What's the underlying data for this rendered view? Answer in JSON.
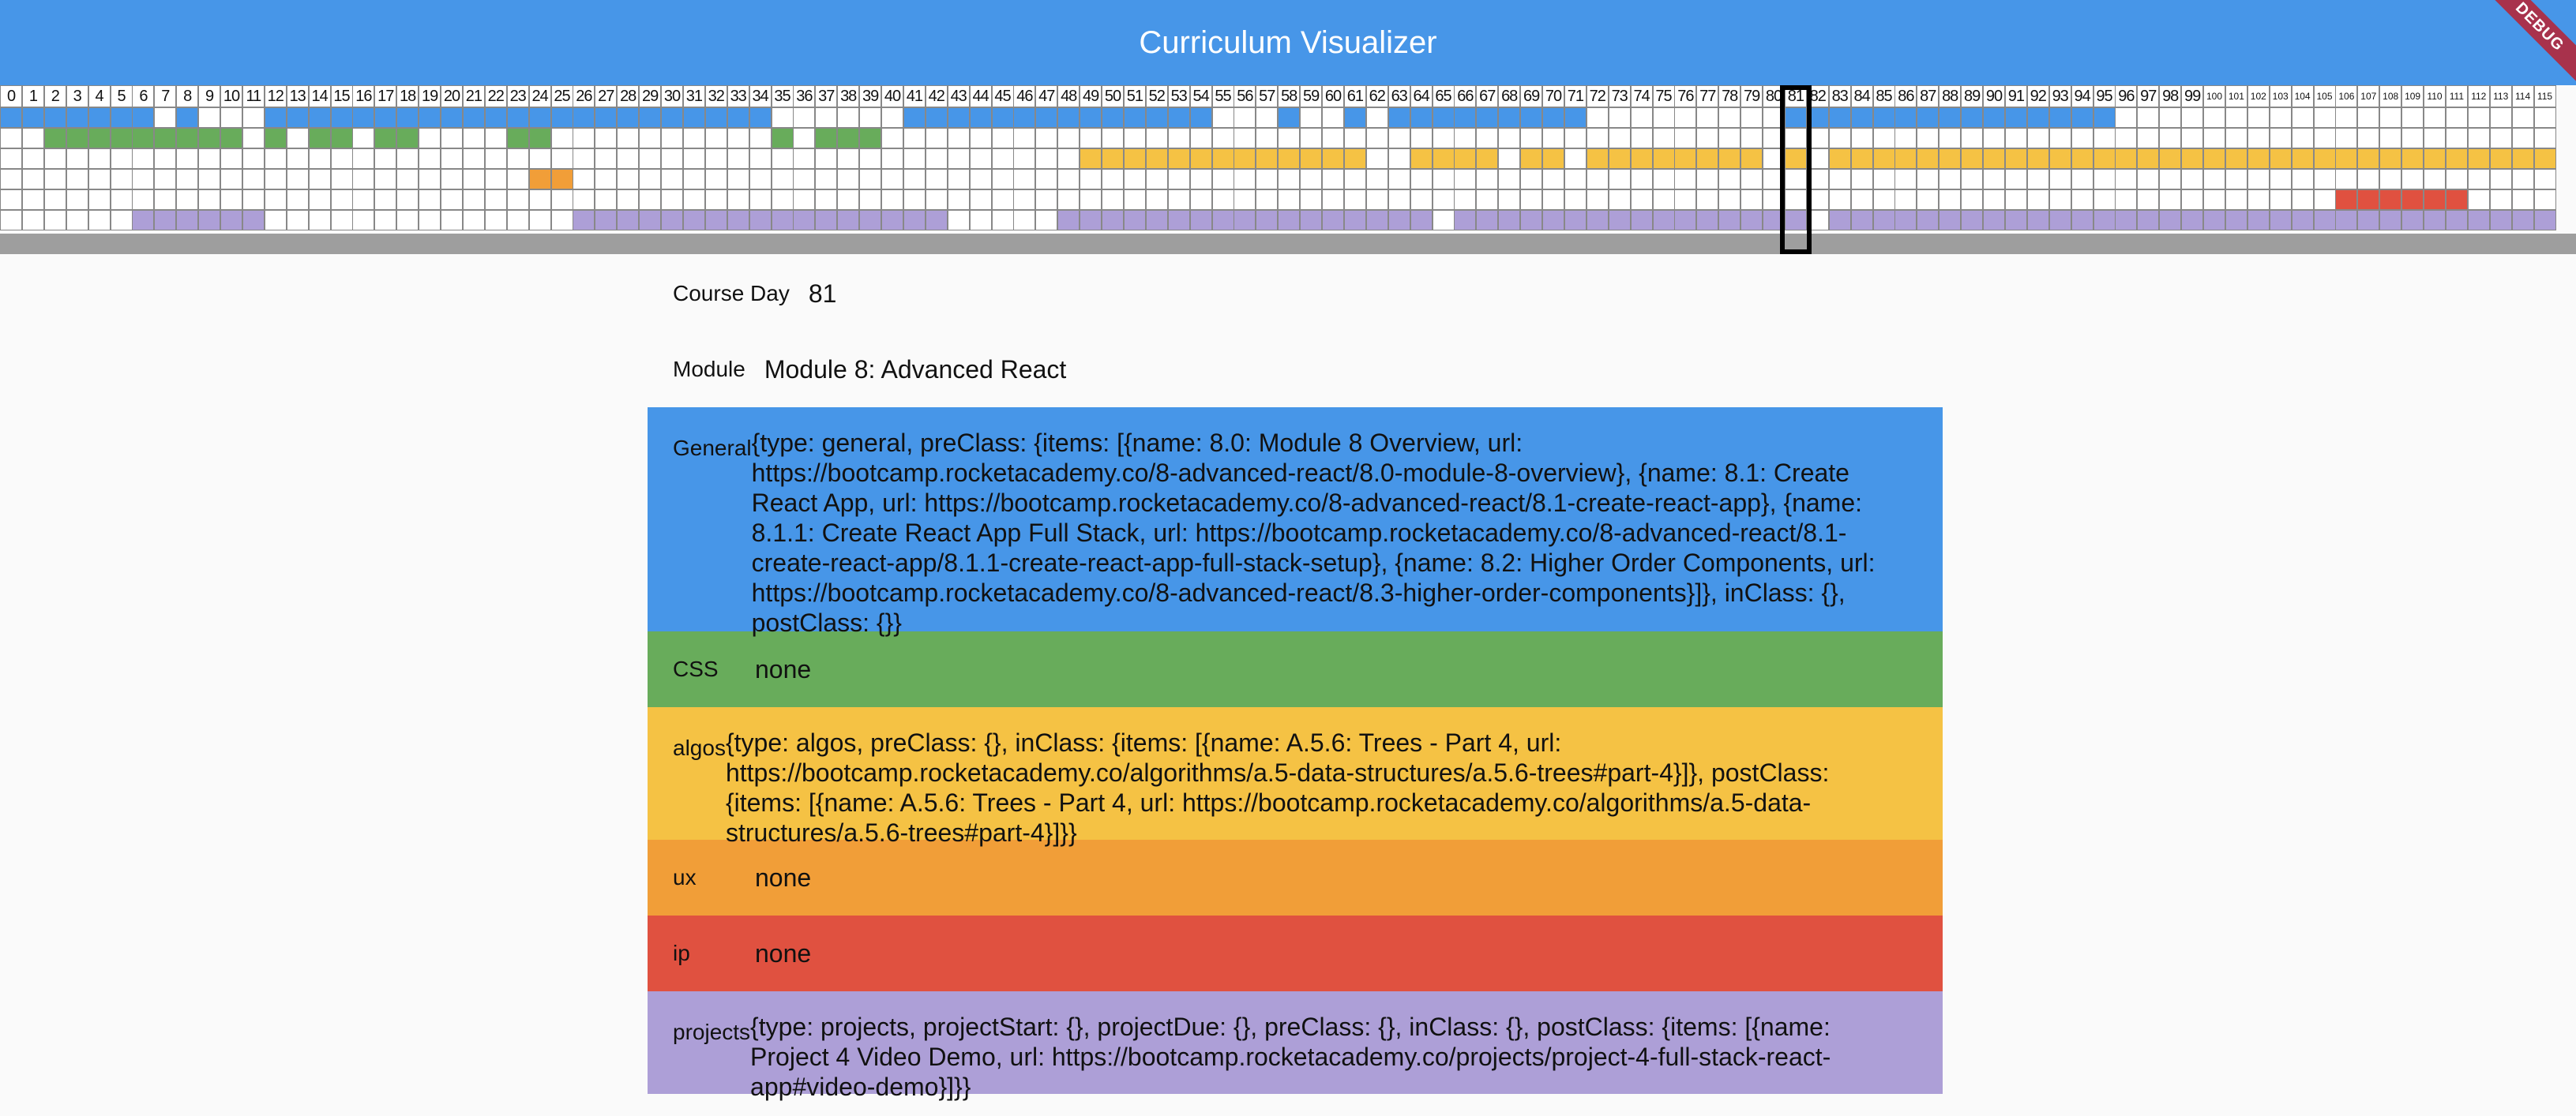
{
  "app": {
    "title": "Curriculum Visualizer",
    "debug_banner": "DEBUG"
  },
  "colors": {
    "appbar": "#4796e8",
    "general": "#4796e8",
    "css": "#68ac5b",
    "algos": "#f5c244",
    "ux": "#f19e38",
    "ip": "#e05140",
    "projects": "#ad9fd7",
    "empty": "#ffffff"
  },
  "calendar": {
    "days": [
      "0",
      "1",
      "2",
      "3",
      "4",
      "5",
      "6",
      "7",
      "8",
      "9",
      "10",
      "11",
      "12",
      "13",
      "14",
      "15",
      "16",
      "17",
      "18",
      "19",
      "20",
      "21",
      "22",
      "23",
      "24",
      "25",
      "26",
      "27",
      "28",
      "29",
      "30",
      "31",
      "32",
      "33",
      "34",
      "35",
      "36",
      "37",
      "38",
      "39",
      "40",
      "41",
      "42",
      "43",
      "44",
      "45",
      "46",
      "47",
      "48",
      "49",
      "50",
      "51",
      "52",
      "53",
      "54",
      "55",
      "56",
      "57",
      "58",
      "59",
      "60",
      "61",
      "62",
      "63",
      "64",
      "65",
      "66",
      "67",
      "68",
      "69",
      "70",
      "71",
      "72",
      "73",
      "74",
      "75",
      "76",
      "77",
      "78",
      "79",
      "80",
      "81",
      "82",
      "83",
      "84",
      "85",
      "86",
      "87",
      "88",
      "89",
      "90",
      "91",
      "92",
      "93",
      "94",
      "95",
      "96",
      "97",
      "98",
      "99",
      "100",
      "101",
      "102",
      "103",
      "104",
      "105",
      "106",
      "107",
      "108",
      "109",
      "110",
      "111",
      "112",
      "113",
      "114",
      "115"
    ],
    "selected_day": 81,
    "category_rows": [
      "general",
      "css",
      "algos",
      "ux",
      "ip",
      "projects"
    ],
    "active_days": {
      "general": [
        0,
        1,
        2,
        3,
        4,
        5,
        6,
        8,
        12,
        13,
        14,
        15,
        16,
        17,
        18,
        19,
        20,
        21,
        22,
        23,
        24,
        25,
        26,
        27,
        28,
        29,
        30,
        31,
        32,
        33,
        34,
        41,
        42,
        43,
        44,
        45,
        46,
        47,
        48,
        49,
        50,
        51,
        52,
        53,
        54,
        58,
        61,
        63,
        64,
        65,
        66,
        67,
        68,
        69,
        70,
        71,
        81,
        82,
        83,
        84,
        85,
        86,
        87,
        88,
        89,
        90,
        91,
        92,
        93,
        94,
        95
      ],
      "css": [
        2,
        3,
        4,
        5,
        6,
        7,
        8,
        9,
        10,
        12,
        14,
        15,
        17,
        18,
        23,
        24,
        35,
        37,
        38,
        39
      ],
      "algos": [
        49,
        50,
        51,
        52,
        53,
        54,
        55,
        56,
        57,
        58,
        59,
        60,
        61,
        64,
        65,
        66,
        67,
        69,
        70,
        72,
        73,
        74,
        75,
        76,
        77,
        78,
        79,
        81,
        83,
        84,
        85,
        86,
        87,
        88,
        89,
        90,
        91,
        92,
        93,
        94,
        95,
        96,
        97,
        98,
        99,
        100,
        101,
        102,
        103,
        104,
        105,
        106,
        107,
        108,
        109,
        110,
        111,
        112,
        113,
        114,
        115
      ],
      "ux": [
        24,
        25
      ],
      "ip": [
        106,
        107,
        108,
        109,
        110,
        111
      ],
      "projects": [
        6,
        7,
        8,
        9,
        10,
        11,
        26,
        27,
        28,
        29,
        30,
        31,
        32,
        33,
        34,
        35,
        36,
        37,
        38,
        39,
        40,
        41,
        42,
        48,
        49,
        50,
        51,
        52,
        53,
        54,
        55,
        56,
        57,
        58,
        59,
        60,
        61,
        62,
        63,
        64,
        66,
        67,
        68,
        69,
        70,
        71,
        72,
        73,
        74,
        75,
        76,
        77,
        78,
        79,
        80,
        81,
        83,
        84,
        85,
        86,
        87,
        88,
        89,
        90,
        91,
        92,
        93,
        94,
        95,
        96,
        97,
        98,
        99,
        100,
        101,
        102,
        103,
        104,
        105,
        106,
        107,
        108,
        109,
        110,
        111,
        112,
        113,
        114,
        115
      ]
    }
  },
  "details": {
    "course_day_label": "Course Day",
    "course_day_value": "81",
    "module_label": "Module",
    "module_value": "Module 8: Advanced React",
    "categories": [
      {
        "key": "general",
        "label": "General",
        "value": "{type: general, preClass: {items: [{name: 8.0: Module 8 Overview, url: https://bootcamp.rocketacademy.co/8-advanced-react/8.0-module-8-overview}, {name: 8.1: Create React App, url: https://bootcamp.rocketacademy.co/8-advanced-react/8.1-create-react-app}, {name: 8.1.1: Create React App Full Stack, url: https://bootcamp.rocketacademy.co/8-advanced-react/8.1-create-react-app/8.1.1-create-react-app-full-stack-setup}, {name: 8.2: Higher Order Components, url: https://bootcamp.rocketacademy.co/8-advanced-react/8.3-higher-order-components}]}, inClass: {}, postClass: {}}"
      },
      {
        "key": "css",
        "label": "CSS",
        "value": "none"
      },
      {
        "key": "algos",
        "label": "algos",
        "value": "{type: algos, preClass: {}, inClass: {items: [{name: A.5.6: Trees - Part 4, url: https://bootcamp.rocketacademy.co/algorithms/a.5-data-structures/a.5.6-trees#part-4}]}, postClass: {items: [{name: A.5.6: Trees - Part 4, url: https://bootcamp.rocketacademy.co/algorithms/a.5-data-structures/a.5.6-trees#part-4}]}}"
      },
      {
        "key": "ux",
        "label": "ux",
        "value": "none"
      },
      {
        "key": "ip",
        "label": "ip",
        "value": "none"
      },
      {
        "key": "projects",
        "label": "projects",
        "value": "{type: projects, projectStart: {}, projectDue: {}, preClass: {}, inClass: {}, postClass: {items: [{name: Project 4 Video Demo, url: https://bootcamp.rocketacademy.co/projects/project-4-full-stack-react-app#video-demo}]}}"
      }
    ]
  }
}
